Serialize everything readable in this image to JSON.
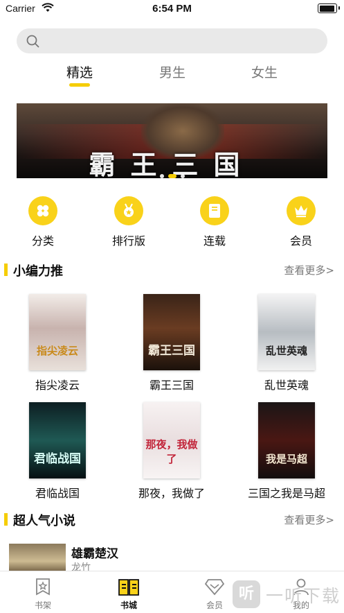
{
  "status": {
    "carrier": "Carrier",
    "time": "6:54 PM"
  },
  "search": {
    "icon": "search-icon"
  },
  "tabs": [
    {
      "label": "精选",
      "active": true
    },
    {
      "label": "男生",
      "active": false
    },
    {
      "label": "女生",
      "active": false
    }
  ],
  "banner": {
    "title": "霸王三国",
    "pages": 3,
    "current_page": 2
  },
  "categories": [
    {
      "label": "分类",
      "icon": "category-icon"
    },
    {
      "label": "排行版",
      "icon": "ranking-medal-icon"
    },
    {
      "label": "连载",
      "icon": "serial-book-icon"
    },
    {
      "label": "会员",
      "icon": "vip-crown-icon"
    }
  ],
  "editor_picks": {
    "title": "小编力推",
    "more": "查看更多>",
    "books": [
      {
        "title": "指尖凌云",
        "cover_text": "指尖凌云"
      },
      {
        "title": "霸王三国",
        "cover_text": "霸王三国"
      },
      {
        "title": "乱世英魂",
        "cover_text": "乱世英魂"
      },
      {
        "title": "君临战国",
        "cover_text": "君临战国"
      },
      {
        "title": "那夜，我做了",
        "cover_text": "那夜，我做了"
      },
      {
        "title": "三国之我是马超",
        "cover_text": "我是马超"
      }
    ]
  },
  "popular": {
    "title": "超人气小说",
    "more": "查看更多>",
    "items": [
      {
        "title": "雄霸楚汉",
        "author": "龙竹"
      }
    ]
  },
  "tabbar": [
    {
      "label": "书架",
      "icon": "bookshelf-star-icon",
      "active": false
    },
    {
      "label": "书城",
      "icon": "book-city-icon",
      "active": true
    },
    {
      "label": "会员",
      "icon": "vip-diamond-icon",
      "active": false
    },
    {
      "label": "我的",
      "icon": "profile-icon",
      "active": false
    }
  ],
  "watermark": {
    "box": "听",
    "text": "一听下载"
  },
  "colors": {
    "accent": "#f5cd05",
    "icon_yellow": "#f9d21a",
    "muted": "#777777"
  }
}
